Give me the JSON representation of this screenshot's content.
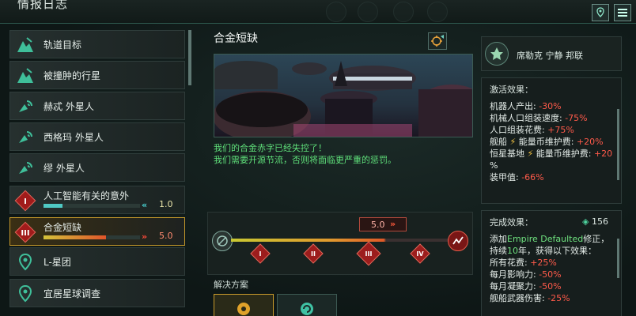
{
  "header": {
    "title": "情报日志"
  },
  "left_list": {
    "items": [
      {
        "label": "轨道目标",
        "icon": "dig-site-icon"
      },
      {
        "label": "被撞肿的行星",
        "icon": "dig-site-icon"
      },
      {
        "label": "赫忒 外星人",
        "icon": "signal-dish-icon"
      },
      {
        "label": "西格玛 外星人",
        "icon": "signal-dish-icon"
      },
      {
        "label": "缪 外星人",
        "icon": "signal-dish-icon"
      },
      {
        "label": "人工智能有关的意外",
        "icon": "crisis-diamond-icon",
        "numeral": "I",
        "progress": 0.2,
        "value": "1.0",
        "trend": "«",
        "trend_color": "#4ad6d6",
        "bar_color": "#4fc9c4"
      },
      {
        "label": "合金短缺",
        "icon": "crisis-diamond-icon",
        "numeral": "III",
        "progress": 0.65,
        "value": "5.0",
        "trend": "»",
        "trend_color": "#ff4a3a",
        "bar_color": "#e9a42e"
      },
      {
        "label": "L-星团",
        "icon": "location-pin-icon"
      },
      {
        "label": "宜居星球调查",
        "icon": "location-pin-icon"
      }
    ]
  },
  "center": {
    "title": "合金短缺",
    "description_line1": "我们的合金赤字已经失控了！",
    "description_line2": "我们需要开源节流，否则将面临更严重的惩罚。",
    "timeline_value": "5.0",
    "timeline_progress": 0.7,
    "markers": [
      "I",
      "II",
      "III",
      "IV"
    ],
    "solutions_label": "解决方案"
  },
  "right": {
    "faction_name": "席勒克 宁静 邦联",
    "active_effects_title": "激活效果：",
    "active_effects": [
      {
        "label": "机器人产出: ",
        "value": "-30%"
      },
      {
        "label": "机械人口组装速度: ",
        "value": "-75%"
      },
      {
        "label": "人口组装花费: ",
        "value": "+75%"
      },
      {
        "label": "舰船 ",
        "label2": "能量币维护费: ",
        "value": "+20%"
      },
      {
        "label": "恒星基地 ",
        "label2": "能量币维护费: ",
        "value": "+20",
        "value_cont": "%"
      },
      {
        "label": "装甲值: ",
        "value": "-66%"
      }
    ],
    "complete_title": "完成效果：",
    "complete_badge": "156",
    "complete_line1_pre": "添加",
    "complete_line1_name": "Empire Defaulted",
    "complete_line1_post": "修正，",
    "complete_line2_pre": "持续",
    "complete_line2_num": "10",
    "complete_line2_post": "年，获得以下效果：",
    "complete_effects": [
      {
        "label": "所有花费: ",
        "value": "+25%"
      },
      {
        "label": "每月影响力: ",
        "value": "-50%"
      },
      {
        "label": "每月凝聚力: ",
        "value": "-50%"
      },
      {
        "label": "舰船武器伤害: ",
        "value": "-25%"
      }
    ]
  }
}
